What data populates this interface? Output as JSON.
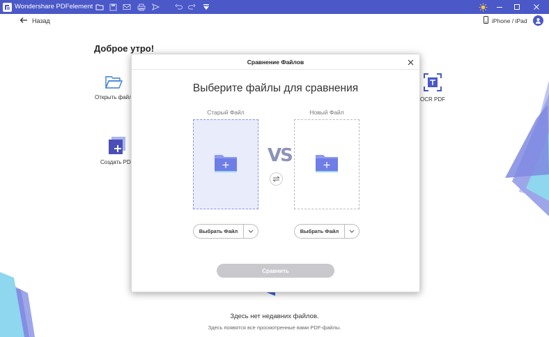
{
  "titlebar": {
    "app_title": "Wondershare PDFelement",
    "icons": [
      "folder-icon",
      "save-icon",
      "mail-icon",
      "print-icon",
      "send-icon",
      "undo-icon",
      "redo-icon",
      "dropdown-icon"
    ],
    "right_icons": [
      "sun-icon",
      "minimize-icon",
      "maximize-icon",
      "close-icon"
    ],
    "bg_color": "#4a58c8"
  },
  "header": {
    "back_label": "Назад",
    "device_label": "iPhone / iPad"
  },
  "home": {
    "greeting": "Доброе утро!",
    "tiles": {
      "open_file": "Открыть файл",
      "create_pdf": "Создать PDF",
      "ocr_pdf": "OCR PDF"
    },
    "empty_title": "Здесь нет недавних файлов.",
    "empty_subtitle": "Здесь появятся все просмотренные вами PDF-файлы."
  },
  "modal": {
    "title": "Сравнение Файлов",
    "heading": "Выберите файлы для сравнения",
    "old_file_label": "Старый Файл",
    "new_file_label": "Новый Файл",
    "vs_label": "VS",
    "select_file_old": "Выбрать Файл",
    "select_file_new": "Выбрать Файл",
    "compare_label": "Сравнить",
    "accent_color": "#6f7de6",
    "compare_disabled_color": "#c9c9cd"
  }
}
